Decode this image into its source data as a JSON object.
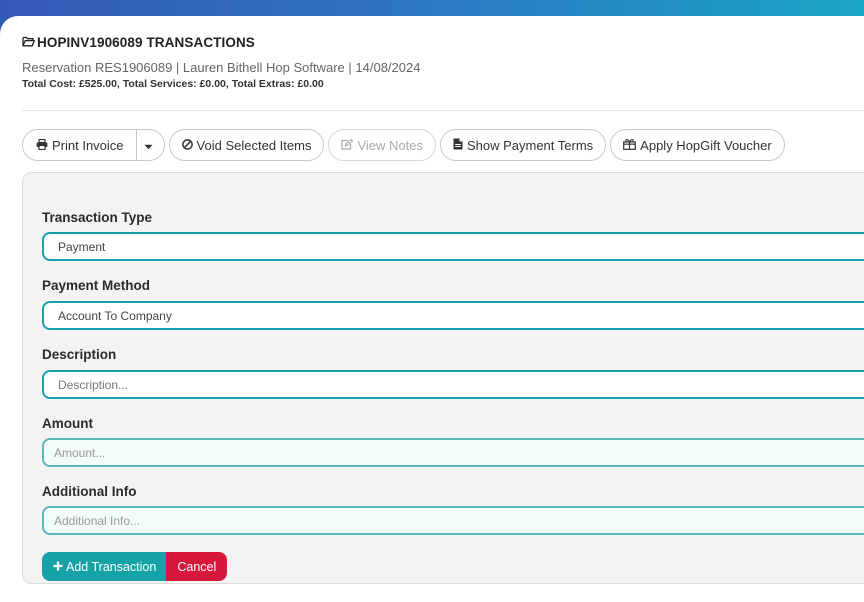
{
  "header": {
    "title": "HOPINV1906089 TRANSACTIONS",
    "subtitle": "Reservation RES1906089 | Lauren Bithell Hop Software | 14/08/2024",
    "totals": "Total Cost: £525.00, Total Services: £0.00, Total Extras: £0.00"
  },
  "toolbar": {
    "print_invoice": "Print Invoice",
    "void_selected": "Void Selected Items",
    "view_notes": "View Notes",
    "show_payment_terms": "Show Payment Terms",
    "apply_voucher": "Apply HopGift Voucher"
  },
  "form": {
    "transaction_type_label": "Transaction Type",
    "transaction_type_value": "Payment",
    "payment_method_label": "Payment Method",
    "payment_method_value": "Account To Company",
    "description_label": "Description",
    "description_placeholder": "Description...",
    "amount_label": "Amount",
    "amount_placeholder": "Amount...",
    "additional_info_label": "Additional Info",
    "additional_info_placeholder": "Additional Info...",
    "add_button": "Add Transaction",
    "cancel_button": "Cancel"
  },
  "colors": {
    "accent": "#17a2a8",
    "danger": "#d6183d",
    "header_gradient_start": "#3558b8",
    "header_gradient_end": "#19a6c6"
  },
  "icons": {
    "title": "folder-open-icon",
    "print": "printer-icon",
    "dropdown": "caret-down-icon",
    "void": "ban-icon",
    "notes": "edit-icon",
    "terms": "file-icon",
    "voucher": "gift-icon",
    "add": "plus-icon"
  }
}
